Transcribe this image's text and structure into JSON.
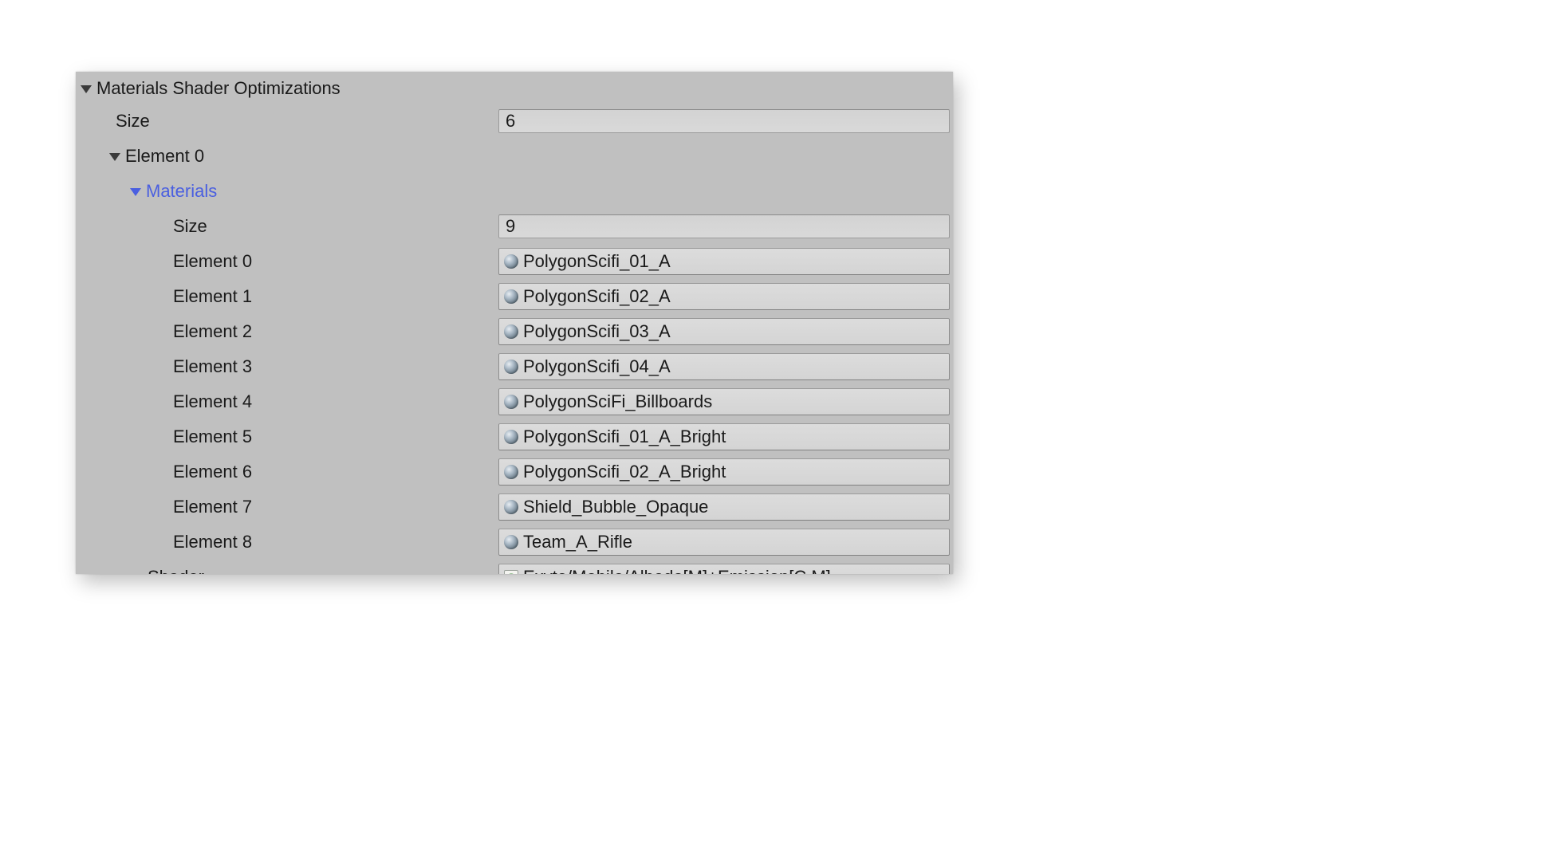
{
  "header": {
    "title": "Materials Shader Optimizations",
    "size_label": "Size",
    "size_value": "6"
  },
  "element0": {
    "label": "Element 0",
    "materials_label": "Materials",
    "materials_size_label": "Size",
    "materials_size_value": "9",
    "items": [
      {
        "label": "Element 0",
        "name": "PolygonScifi_01_A"
      },
      {
        "label": "Element 1",
        "name": "PolygonScifi_02_A"
      },
      {
        "label": "Element 2",
        "name": "PolygonScifi_03_A"
      },
      {
        "label": "Element 3",
        "name": "PolygonScifi_04_A"
      },
      {
        "label": "Element 4",
        "name": "PolygonSciFi_Billboards"
      },
      {
        "label": "Element 5",
        "name": "PolygonScifi_01_A_Bright"
      },
      {
        "label": "Element 6",
        "name": "PolygonScifi_02_A_Bright"
      },
      {
        "label": "Element 7",
        "name": "Shield_Bubble_Opaque"
      },
      {
        "label": "Element 8",
        "name": "Team_A_Rifle"
      }
    ],
    "shader_label": "Shader",
    "shader_value": "Exyte/Mobile/Albedo[M]+Emission[C,M]"
  }
}
